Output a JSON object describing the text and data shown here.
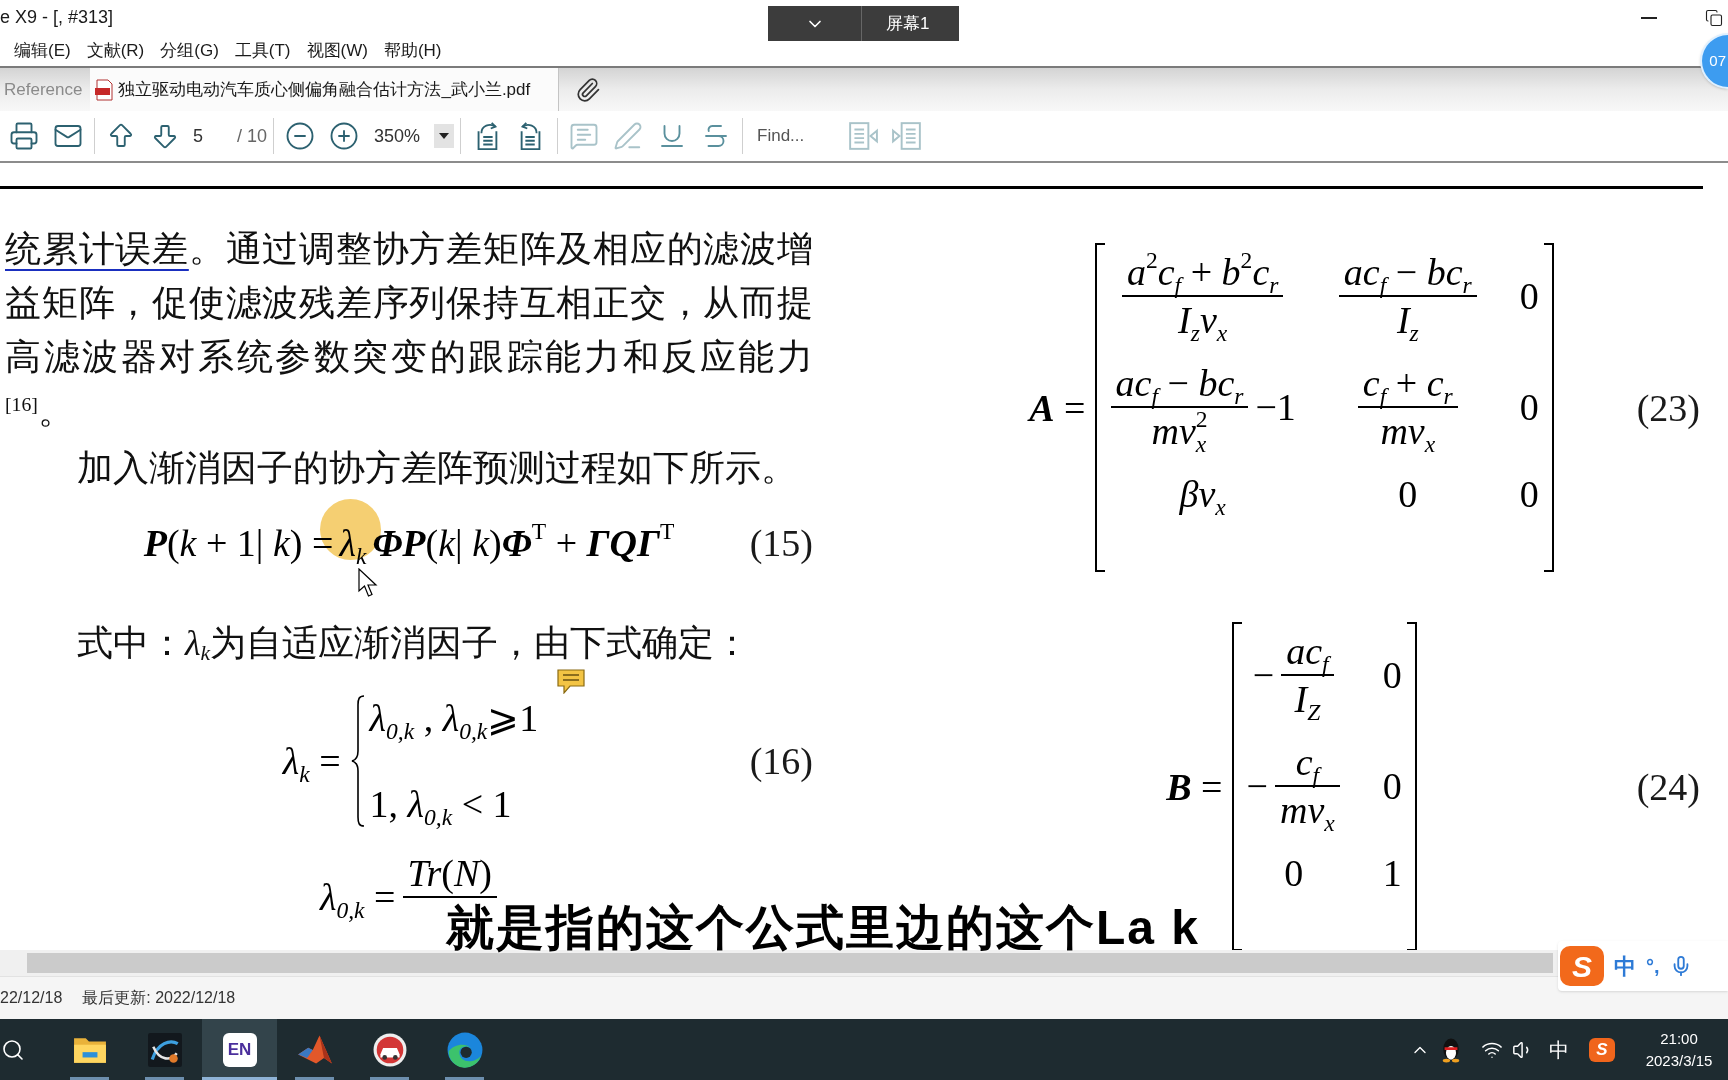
{
  "window": {
    "title": "e X9 - [, #313]"
  },
  "recorder_bar": {
    "label": "屏幕1"
  },
  "floating_badge": {
    "text": "07"
  },
  "menu": [
    {
      "label": "编辑(E)"
    },
    {
      "label": "文献(R)"
    },
    {
      "label": "分组(G)"
    },
    {
      "label": "工具(T)"
    },
    {
      "label": "视图(W)"
    },
    {
      "label": "帮助(H)"
    }
  ],
  "tabs": [
    {
      "kind": "reference",
      "label": "Reference",
      "selected": false
    },
    {
      "kind": "pdf",
      "label": "独立驱动电动汽车质心侧偏角融合估计方法_武小兰.pdf",
      "selected": true
    }
  ],
  "toolbar": {
    "groups": [
      [
        {
          "kind": "print",
          "disabled": false
        },
        {
          "kind": "email",
          "disabled": false
        }
      ],
      [
        {
          "kind": "previous_page",
          "disabled": false
        },
        {
          "kind": "next_page",
          "disabled": false
        },
        {
          "kind": "page_field",
          "value": "5",
          "total": "/ 10",
          "disabled": false
        }
      ],
      [
        {
          "kind": "zoom_out",
          "disabled": false
        },
        {
          "kind": "zoom_in",
          "disabled": false
        },
        {
          "kind": "zoom_field",
          "value": "350%",
          "disabled": false
        }
      ],
      [
        {
          "kind": "rotate_left",
          "disabled": false
        },
        {
          "kind": "rotate_right",
          "disabled": false
        }
      ],
      [
        {
          "kind": "comment",
          "disabled": true
        },
        {
          "kind": "highlight_text",
          "disabled": true
        },
        {
          "kind": "underline",
          "disabled": false
        },
        {
          "kind": "strikethrough",
          "disabled": false
        }
      ],
      [
        {
          "kind": "find_field",
          "placeholder": "Find...",
          "disabled": false
        },
        {
          "kind": "find_previous",
          "disabled": true
        },
        {
          "kind": "find_next",
          "disabled": true
        }
      ]
    ]
  },
  "document": {
    "left_column": [
      {
        "kind": "paragraph",
        "first_line_indent": false,
        "comment_note": false,
        "lines": [
          {
            "underlined": "统累计误差",
            "text": "。通过调整协方差矩阵及相应的滤波增"
          },
          {
            "text": "益矩阵，促使滤波残差序列保持互相正交，从而提"
          },
          {
            "text": "高滤波器对系统参数突变的跟踪能力和反应能力"
          },
          {
            "text": "$^{[16]}$。"
          }
        ]
      },
      {
        "kind": "paragraph",
        "first_line_indent": true,
        "comment_note": false,
        "lines": [
          {
            "text": "加入渐消因子的协方差阵预测过程如下所示。"
          }
        ]
      },
      {
        "kind": "equation",
        "number": "(15)",
        "body": [
          {
            "kind": "text",
            "text": "**P**(*k* + 1| *k*) ="
          },
          {
            "kind": "text",
            "text": "*λ*$_{k}$"
          },
          {
            "kind": "text",
            "text": "**ΦP**(*k*| *k*)**Φ**$^{T}$ + **ΓQΓ**$^{T}$"
          }
        ]
      },
      {
        "kind": "paragraph",
        "first_line_indent": true,
        "comment_note": true,
        "lines": [
          {
            "text": "式中：*λ*$_{k}$为自适应渐消因子，由下式确定："
          }
        ]
      },
      {
        "kind": "equation",
        "number": "(16)",
        "body": [
          {
            "kind": "text",
            "text": "*λ*$_{k}$ ="
          },
          {
            "kind": "cases",
            "rows": [
              "*λ*$_{0,k}$ , *λ*$_{0,k}$⩾1",
              "1, *λ*$_{0,k}$ < 1"
            ]
          }
        ]
      },
      {
        "kind": "equation",
        "body": [
          {
            "kind": "text",
            "text": "*λ*$_{0,k}$ ="
          },
          {
            "kind": "fraction",
            "numerator": "*Tr*(*N*)"
          }
        ]
      }
    ],
    "right_column": [
      {
        "kind": "equation",
        "number": "(23)",
        "body": [
          {
            "kind": "text",
            "text": "**A** ="
          },
          {
            "kind": "matrix",
            "rows": [
              [
                [
                  {
                    "kind": "fraction",
                    "numerator": "*a*$^{2}$*c*$_{f}$ + *b*$^{2}$*c*$_{r}$",
                    "denominator": "*I*$_{z}$*v*$_{x}$"
                  }
                ],
                [
                  {
                    "kind": "fraction",
                    "numerator": "*ac*$_{f}$ − *bc*$_{r}$",
                    "denominator": "*I*$_{z}$"
                  }
                ],
                [
                  {
                    "kind": "text",
                    "text": "0"
                  }
                ]
              ],
              [
                [
                  {
                    "kind": "fraction",
                    "numerator": "*ac*$_{f}$ − *bc*$_{r}$",
                    "denominator": "*mv*$_{x}$$^{2}$"
                  },
                  {
                    "kind": "text",
                    "text": "−1"
                  }
                ],
                [
                  {
                    "kind": "fraction",
                    "numerator": "*c*$_{f}$ + *c*$_{r}$",
                    "denominator": "*mv*$_{x}$"
                  }
                ],
                [
                  {
                    "kind": "text",
                    "text": "0"
                  }
                ]
              ],
              [
                [
                  {
                    "kind": "text",
                    "text": "*βv*$_{x}$"
                  }
                ],
                [
                  {
                    "kind": "text",
                    "text": "0"
                  }
                ],
                [
                  {
                    "kind": "text",
                    "text": "0"
                  }
                ]
              ]
            ]
          }
        ]
      },
      {
        "kind": "equation",
        "number": "(24)",
        "body": [
          {
            "kind": "text",
            "text": "**B** ="
          },
          {
            "kind": "matrix",
            "rows": [
              [
                [
                  {
                    "kind": "text",
                    "text": "−"
                  },
                  {
                    "kind": "fraction",
                    "numerator": "*ac*$_{f}$",
                    "denominator": "*I*$_{Z}$"
                  }
                ],
                [
                  {
                    "kind": "text",
                    "text": "0"
                  }
                ]
              ],
              [
                [
                  {
                    "kind": "text",
                    "text": "−"
                  },
                  {
                    "kind": "fraction",
                    "numerator": "*c*$_{f}$",
                    "denominator": "*mv*$_{x}$"
                  }
                ],
                [
                  {
                    "kind": "text",
                    "text": "0"
                  }
                ]
              ],
              [
                [
                  {
                    "kind": "text",
                    "text": "0"
                  }
                ],
                [
                  {
                    "kind": "text",
                    "text": "1"
                  }
                ]
              ]
            ]
          }
        ]
      }
    ]
  },
  "subtitle": "就是指的这个公式里边的这个La k",
  "status_bar": [
    {
      "text": "22/12/18"
    },
    {
      "text": "最后更新: 2022/12/18"
    }
  ],
  "ime_toolbar": {
    "logo": "S",
    "mode": "中",
    "punctuation": "°,"
  },
  "taskbar": {
    "apps": [
      {
        "kind": "file_explorer",
        "selected": false
      },
      {
        "kind": "cad_app",
        "selected": false
      },
      {
        "kind": "endnote",
        "label": "EN",
        "selected": true
      },
      {
        "kind": "matlab",
        "selected": false
      },
      {
        "kind": "car_app",
        "selected": false
      },
      {
        "kind": "edge",
        "selected": false
      }
    ],
    "tray": {
      "ime_mode": "中",
      "ime_logo": "S"
    },
    "clock": {
      "time": "21:00",
      "date": "2023/3/15"
    }
  }
}
